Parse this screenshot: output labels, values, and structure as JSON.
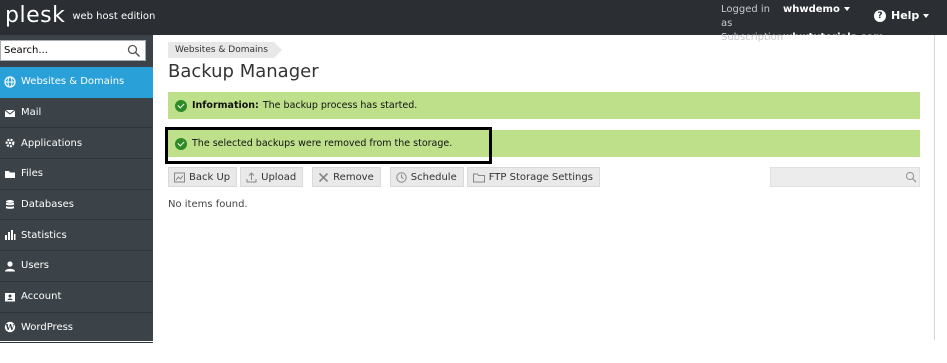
{
  "header": {
    "logo_word": "plesk",
    "logo_edition": "web host edition",
    "logged_in_label": "Logged in as",
    "logged_in_user": "whwdemo",
    "subscription_label": "Subscription",
    "subscription_value": "whwtutorials.com",
    "help_label": "Help"
  },
  "sidebar": {
    "search_placeholder": "Search...",
    "items": [
      {
        "label": "Websites & Domains",
        "icon": "globe-icon",
        "active": true
      },
      {
        "label": "Mail",
        "icon": "mail-icon"
      },
      {
        "label": "Applications",
        "icon": "gear-icon"
      },
      {
        "label": "Files",
        "icon": "folder-icon"
      },
      {
        "label": "Databases",
        "icon": "database-icon"
      },
      {
        "label": "Statistics",
        "icon": "bar-chart-icon"
      },
      {
        "label": "Users",
        "icon": "user-icon"
      },
      {
        "label": "Account",
        "icon": "id-card-icon"
      },
      {
        "label": "WordPress",
        "icon": "wordpress-icon"
      }
    ]
  },
  "main": {
    "breadcrumb": "Websites & Domains",
    "title": "Backup Manager",
    "messages": [
      {
        "prefix": "Information:",
        "text": "The backup process has started."
      },
      {
        "prefix": "",
        "text": "The selected backups were removed from the storage."
      }
    ],
    "toolbar": {
      "backup": "Back Up",
      "upload": "Upload",
      "remove": "Remove",
      "schedule": "Schedule",
      "ftp": "FTP Storage Settings"
    },
    "empty_text": "No items found."
  },
  "colors": {
    "header_bg": "#2b2f33",
    "sidebar_bg": "#3c4348",
    "active_item": "#29a1d8",
    "success_bg": "#bfe08a",
    "success_icon": "#2f8a26"
  }
}
